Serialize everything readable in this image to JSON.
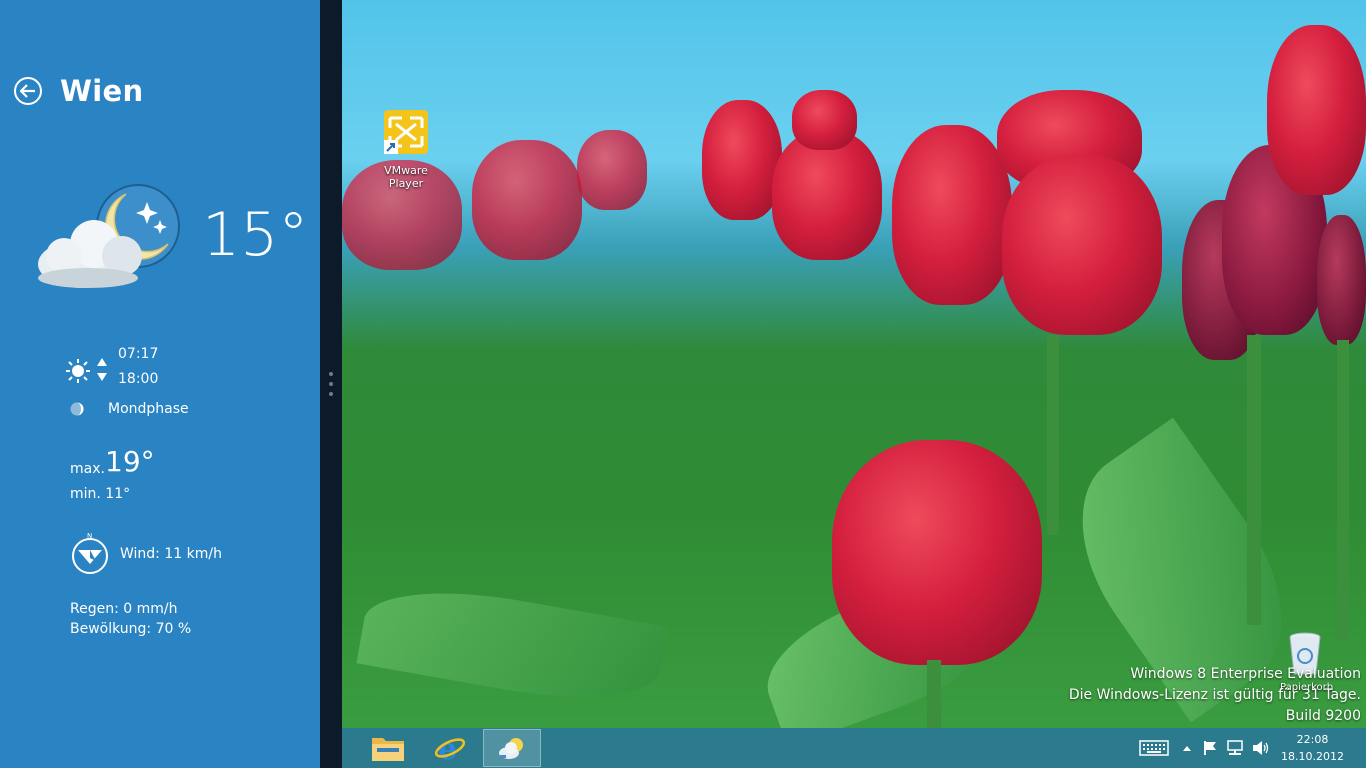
{
  "weather_app": {
    "city": "Wien",
    "temperature": "15°",
    "condition_icon": "partly-cloudy-night-icon",
    "sunrise": "07:17",
    "sunset": "18:00",
    "moon_label": "Mondphase",
    "max_label": "max.",
    "max_value": "19°",
    "min_label": "min. 11°",
    "wind": "Wind: 11 km/h",
    "rain": "Regen: 0 mm/h",
    "clouds": "Bewölkung: 70 %",
    "colors": {
      "panel": "#2a83c2"
    }
  },
  "desktop": {
    "icons": [
      {
        "label": "VMware Player",
        "icon": "vmware-player-icon"
      },
      {
        "label": "Papierkorb",
        "icon": "recycle-bin-icon"
      }
    ],
    "watermark": {
      "line1": "Windows 8 Enterprise Evaluation",
      "line2": "Die Windows-Lizenz ist gültig für 31 Tage.",
      "line3": "Build 9200"
    }
  },
  "taskbar": {
    "pinned": [
      {
        "name": "file-explorer",
        "icon": "folder-icon"
      },
      {
        "name": "internet-explorer",
        "icon": "ie-icon"
      },
      {
        "name": "weather",
        "icon": "weather-app-icon",
        "active": true
      }
    ],
    "tray_icons": [
      "keyboard-icon",
      "chevron-up-icon",
      "flag-icon",
      "network-icon",
      "speaker-icon"
    ],
    "time": "22:08",
    "date": "18.10.2012"
  }
}
